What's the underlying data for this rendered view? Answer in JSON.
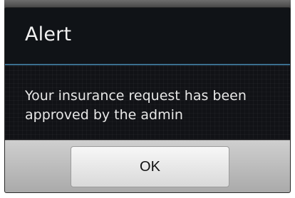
{
  "dialog": {
    "title": "Alert",
    "message": "Your insurance request has been approved by the admin",
    "ok_label": "OK"
  }
}
